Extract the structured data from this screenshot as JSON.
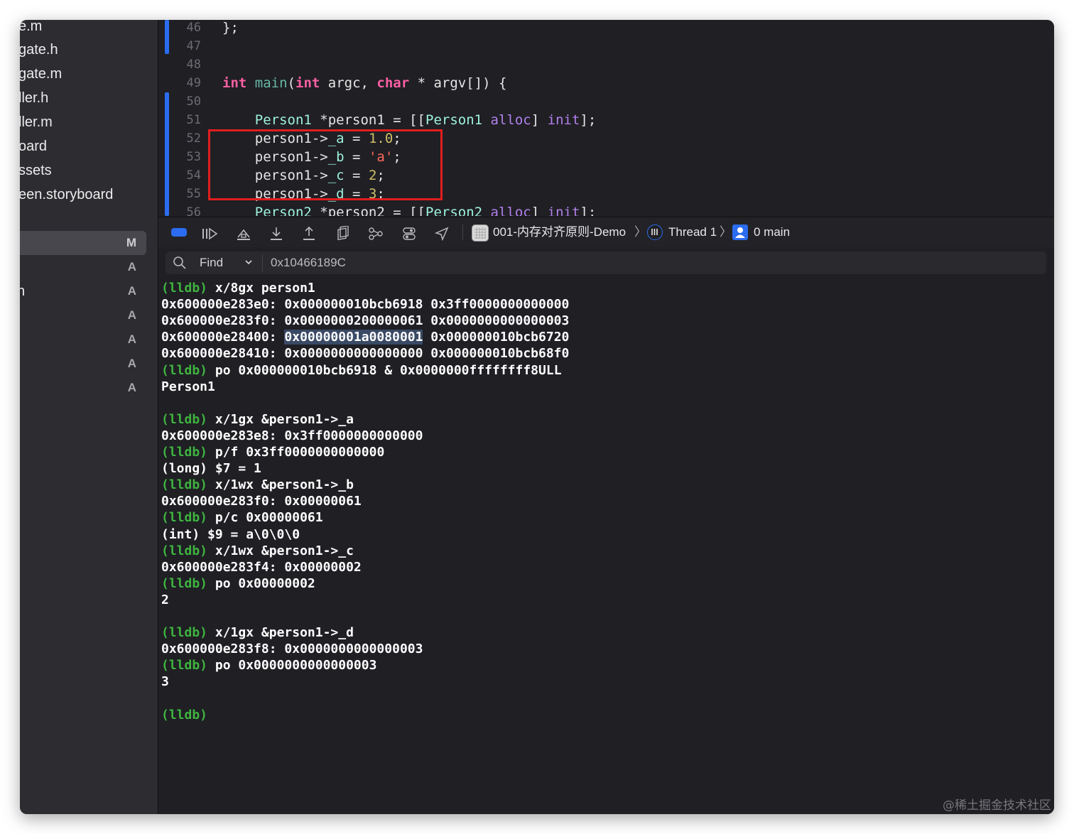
{
  "sidebar": {
    "files": [
      "e.m",
      "gate.h",
      "gate.m",
      "ller.h",
      "ller.m",
      "oard",
      "ssets",
      "een.storyboard"
    ],
    "status_rows": [
      {
        "name": "",
        "letter": "M"
      },
      {
        "name": "",
        "letter": "A"
      },
      {
        "name": "n",
        "letter": "A"
      },
      {
        "name": "",
        "letter": "A"
      },
      {
        "name": "",
        "letter": "A"
      },
      {
        "name": "",
        "letter": "A"
      },
      {
        "name": "",
        "letter": "A"
      }
    ]
  },
  "editor": {
    "line_numbers": [
      "46",
      "47",
      "48",
      "49",
      "50",
      "51",
      "52",
      "53",
      "54",
      "55",
      "56"
    ],
    "lines": [
      "};",
      "",
      "",
      "int main(int argc, char * argv[]) {",
      "",
      "    Person1 *person1 = [[Person1 alloc] init];",
      "    person1->_a = 1.0;",
      "    person1->_b = 'a';",
      "    person1->_c = 2;",
      "    person1->_d = 3;",
      "    Person2 *person2 = [[Person2 alloc] init];"
    ]
  },
  "debug_bar": {
    "target": "001-内存对齐原则-Demo",
    "thread": "Thread 1",
    "frame": "0 main",
    "icons": [
      "breakpoints-toggle-icon",
      "continue-icon",
      "step-over-icon",
      "step-into-icon",
      "step-out-icon",
      "debug-view-hierarchy-icon",
      "memory-graph-icon",
      "environment-overrides-icon",
      "simulate-location-icon"
    ]
  },
  "find": {
    "label": "Find",
    "value": "0x10466189C"
  },
  "console": {
    "prompt": "(lldb)",
    "lines": [
      {
        "prompt": true,
        "text": " x/8gx person1"
      },
      {
        "prompt": false,
        "text": "0x600000e283e0: 0x000000010bcb6918 0x3ff0000000000000"
      },
      {
        "prompt": false,
        "text": "0x600000e283f0: 0x0000000200000061 0x0000000000000003"
      },
      {
        "prompt": false,
        "text": "0x600000e28400: ",
        "selected": "0x00000001a0080001",
        "after": " 0x000000010bcb6720"
      },
      {
        "prompt": false,
        "text": "0x600000e28410: 0x0000000000000000 0x000000010bcb68f0"
      },
      {
        "prompt": true,
        "text": " po 0x000000010bcb6918 & 0x0000000ffffffff8ULL"
      },
      {
        "prompt": false,
        "text": "Person1"
      },
      {
        "prompt": false,
        "text": ""
      },
      {
        "prompt": true,
        "text": " x/1gx &person1->_a"
      },
      {
        "prompt": false,
        "text": "0x600000e283e8: 0x3ff0000000000000"
      },
      {
        "prompt": true,
        "text": " p/f 0x3ff0000000000000"
      },
      {
        "prompt": false,
        "text": "(long) $7 = 1"
      },
      {
        "prompt": true,
        "text": " x/1wx &person1->_b"
      },
      {
        "prompt": false,
        "text": "0x600000e283f0: 0x00000061"
      },
      {
        "prompt": true,
        "text": " p/c 0x00000061"
      },
      {
        "prompt": false,
        "text": "(int) $9 = a\\0\\0\\0"
      },
      {
        "prompt": true,
        "text": " x/1wx &person1->_c"
      },
      {
        "prompt": false,
        "text": "0x600000e283f4: 0x00000002"
      },
      {
        "prompt": true,
        "text": " po 0x00000002"
      },
      {
        "prompt": false,
        "text": "2"
      },
      {
        "prompt": false,
        "text": ""
      },
      {
        "prompt": true,
        "text": " x/1gx &person1->_d"
      },
      {
        "prompt": false,
        "text": "0x600000e283f8: 0x0000000000000003"
      },
      {
        "prompt": true,
        "text": " po 0x0000000000000003"
      },
      {
        "prompt": false,
        "text": "3"
      },
      {
        "prompt": false,
        "text": ""
      },
      {
        "prompt": true,
        "text": ""
      }
    ]
  },
  "watermark": "@稀土掘金技术社区",
  "colors": {
    "accent": "#2b6cf0",
    "highlight_box": "#e01e1e",
    "prompt": "#3fb43f"
  }
}
